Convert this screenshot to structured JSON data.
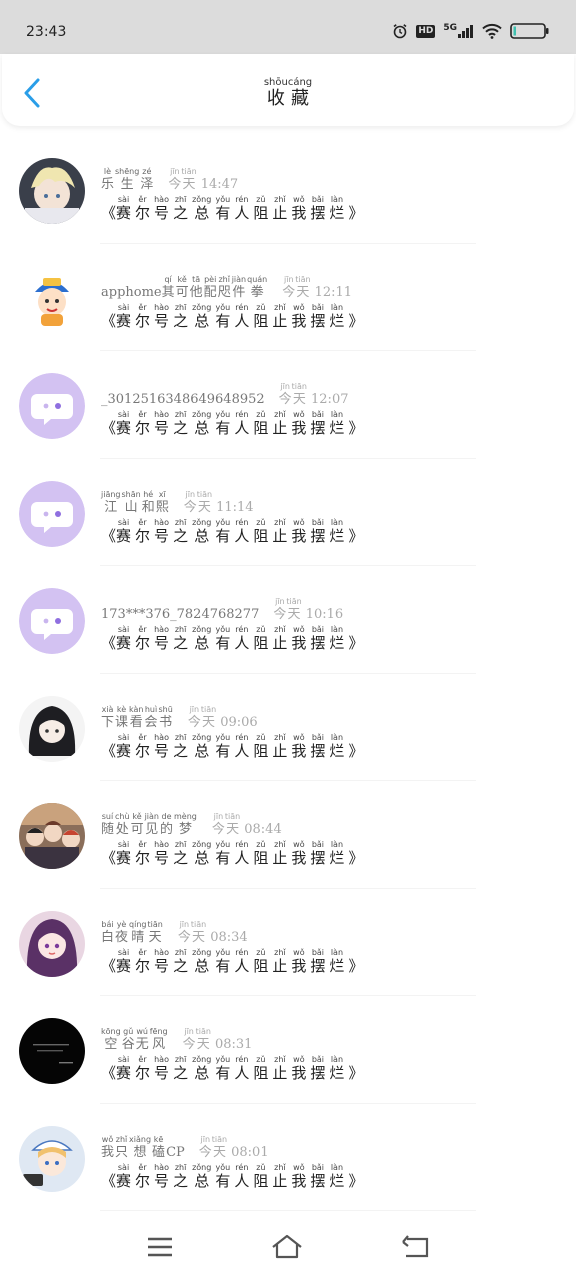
{
  "status_bar": {
    "time": "23:43",
    "icons": [
      "alarm-icon",
      "hd-icon",
      "signal-5g-icon",
      "wifi-icon",
      "battery-icon"
    ],
    "network_label": "5G",
    "hd_label": "HD"
  },
  "header": {
    "title": [
      {
        "ch": "收",
        "py": "shōu"
      },
      {
        "ch": "藏",
        "py": "cáng"
      }
    ]
  },
  "colors": {
    "accent": "#2a9ee8",
    "status_bar_bg": "#dcdcdc",
    "default_avatar_bg": "#d3c2f2"
  },
  "items": [
    {
      "avatar": "anime-blond-boy",
      "name_ruby": [
        {
          "ch": "乐",
          "py": "lè"
        },
        {
          "ch": "生",
          "py": "shēng"
        },
        {
          "ch": "泽",
          "py": "zé"
        }
      ],
      "name_plain": "",
      "day": [
        {
          "ch": "今",
          "py": "jīn"
        },
        {
          "ch": "天",
          "py": "tiān"
        }
      ],
      "time": "14:47"
    },
    {
      "avatar": "cartoon-kid",
      "name_plain": "apphome",
      "name_ruby": [
        {
          "ch": "其",
          "py": "qí"
        },
        {
          "ch": "可",
          "py": "kě"
        },
        {
          "ch": "他",
          "py": "tā"
        },
        {
          "ch": "配",
          "py": "pèi"
        },
        {
          "ch": "咫",
          "py": "zhǐ"
        },
        {
          "ch": "件",
          "py": "jiàn"
        },
        {
          "ch": "拳",
          "py": "quán"
        }
      ],
      "day": [
        {
          "ch": "今",
          "py": "jīn"
        },
        {
          "ch": "天",
          "py": "tiān"
        }
      ],
      "time": "12:11"
    },
    {
      "avatar": "default-chat",
      "name_plain": "_3012516348649648952",
      "name_ruby": [],
      "day": [
        {
          "ch": "今",
          "py": "jīn"
        },
        {
          "ch": "天",
          "py": "tiān"
        }
      ],
      "time": "12:07"
    },
    {
      "avatar": "default-chat",
      "name_plain": "",
      "name_ruby": [
        {
          "ch": "江",
          "py": "jiāng"
        },
        {
          "ch": "山",
          "py": "shān"
        },
        {
          "ch": "和",
          "py": "hé"
        },
        {
          "ch": "熙",
          "py": "xī"
        }
      ],
      "day": [
        {
          "ch": "今",
          "py": "jīn"
        },
        {
          "ch": "天",
          "py": "tiān"
        }
      ],
      "time": "11:14"
    },
    {
      "avatar": "default-chat",
      "name_plain": "173***376_7824768277",
      "name_ruby": [],
      "day": [
        {
          "ch": "今",
          "py": "jīn"
        },
        {
          "ch": "天",
          "py": "tiān"
        }
      ],
      "time": "10:16"
    },
    {
      "avatar": "anime-dark-hair",
      "name_plain": "",
      "name_ruby": [
        {
          "ch": "下",
          "py": "xià"
        },
        {
          "ch": "课",
          "py": "kè"
        },
        {
          "ch": "看",
          "py": "kàn"
        },
        {
          "ch": "会",
          "py": "huì"
        },
        {
          "ch": "书",
          "py": "shū"
        }
      ],
      "day": [
        {
          "ch": "今",
          "py": "jīn"
        },
        {
          "ch": "天",
          "py": "tiān"
        }
      ],
      "time": "09:06"
    },
    {
      "avatar": "anime-group",
      "name_plain": "",
      "name_ruby": [
        {
          "ch": "随",
          "py": "suí"
        },
        {
          "ch": "处",
          "py": "chù"
        },
        {
          "ch": "可",
          "py": "kě"
        },
        {
          "ch": "见",
          "py": "jiàn"
        },
        {
          "ch": "的",
          "py": "de"
        },
        {
          "ch": "梦",
          "py": "mèng"
        }
      ],
      "day": [
        {
          "ch": "今",
          "py": "jīn"
        },
        {
          "ch": "天",
          "py": "tiān"
        }
      ],
      "time": "08:44"
    },
    {
      "avatar": "anime-purple-girl",
      "name_plain": "",
      "name_ruby": [
        {
          "ch": "白",
          "py": "bái"
        },
        {
          "ch": "夜",
          "py": "yè"
        },
        {
          "ch": "晴",
          "py": "qíng"
        },
        {
          "ch": "天",
          "py": "tiān"
        }
      ],
      "day": [
        {
          "ch": "今",
          "py": "jīn"
        },
        {
          "ch": "天",
          "py": "tiān"
        }
      ],
      "time": "08:34"
    },
    {
      "avatar": "black-text",
      "name_plain": "",
      "name_ruby": [
        {
          "ch": "空",
          "py": "kōng"
        },
        {
          "ch": "谷",
          "py": "gǔ"
        },
        {
          "ch": "无",
          "py": "wú"
        },
        {
          "ch": "风",
          "py": "fēng"
        }
      ],
      "day": [
        {
          "ch": "今",
          "py": "jīn"
        },
        {
          "ch": "天",
          "py": "tiān"
        }
      ],
      "time": "08:31"
    },
    {
      "avatar": "anime-nurse",
      "name_plain": "",
      "name_ruby": [
        {
          "ch": "我",
          "py": "wǒ"
        },
        {
          "ch": "只",
          "py": "zhǐ"
        },
        {
          "ch": "想",
          "py": "xiǎng"
        },
        {
          "ch": "磕",
          "py": "kē"
        }
      ],
      "name_suffix": "CP",
      "day": [
        {
          "ch": "今",
          "py": "jīn"
        },
        {
          "ch": "天",
          "py": "tiān"
        }
      ],
      "time": "08:01"
    }
  ],
  "message": {
    "open": "《",
    "close": "》",
    "chars": [
      {
        "ch": "赛",
        "py": "sài"
      },
      {
        "ch": "尔",
        "py": "ěr"
      },
      {
        "ch": "号",
        "py": "hào"
      },
      {
        "ch": "之",
        "py": "zhī"
      },
      {
        "ch": "总",
        "py": "zǒng"
      },
      {
        "ch": "有",
        "py": "yǒu"
      },
      {
        "ch": "人",
        "py": "rén"
      },
      {
        "ch": "阻",
        "py": "zǔ"
      },
      {
        "ch": "止",
        "py": "zhǐ"
      },
      {
        "ch": "我",
        "py": "wǒ"
      },
      {
        "ch": "摆",
        "py": "bǎi"
      },
      {
        "ch": "烂",
        "py": "làn"
      }
    ]
  },
  "bottom_nav": {
    "items": [
      "menu-icon",
      "home-icon",
      "back-icon"
    ]
  }
}
